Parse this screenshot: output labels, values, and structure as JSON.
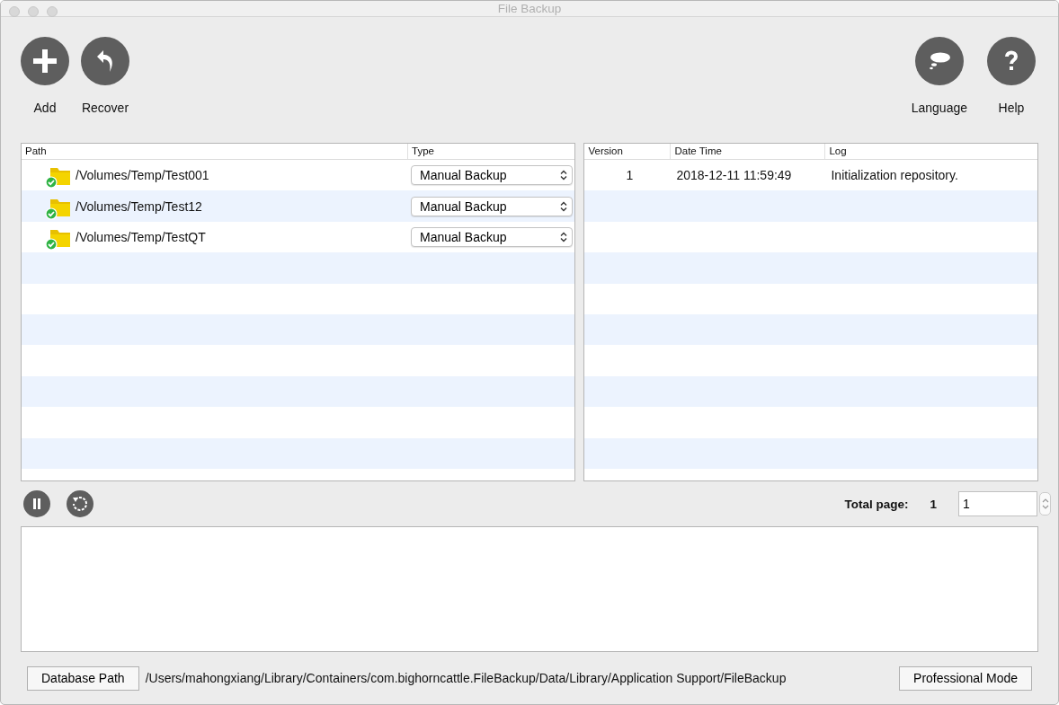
{
  "window": {
    "title": "File Backup"
  },
  "toolbar_left": [
    {
      "kind": "add",
      "label": "Add"
    },
    {
      "kind": "recover",
      "label": "Recover"
    }
  ],
  "toolbar_right": [
    {
      "kind": "language",
      "label": "Language"
    },
    {
      "kind": "help",
      "label": "Help"
    }
  ],
  "paths_table": {
    "columns": [
      "Path",
      "Type"
    ],
    "rows": [
      {
        "path": "/Volumes/Temp/Test001",
        "synced": true,
        "type": "Manual Backup"
      },
      {
        "path": "/Volumes/Temp/Test12",
        "synced": true,
        "type": "Manual Backup"
      },
      {
        "path": "/Volumes/Temp/TestQT",
        "synced": true,
        "type": "Manual Backup"
      }
    ]
  },
  "versions_table": {
    "columns": [
      "Version",
      "Date Time",
      "Log"
    ],
    "rows": [
      {
        "version": "1",
        "date_time": "2018-12-11 11:59:49",
        "log": "Initialization repository."
      }
    ]
  },
  "pager": {
    "label": "Total page:",
    "total": "1",
    "value": "1"
  },
  "bottom_bar": {
    "database_button": "Database Path",
    "database_path": "/Users/mahongxiang/Library/Containers/com.bighorncattle.FileBackup/Data/Library/Application Support/FileBackup",
    "mode_button": "Professional Mode"
  }
}
